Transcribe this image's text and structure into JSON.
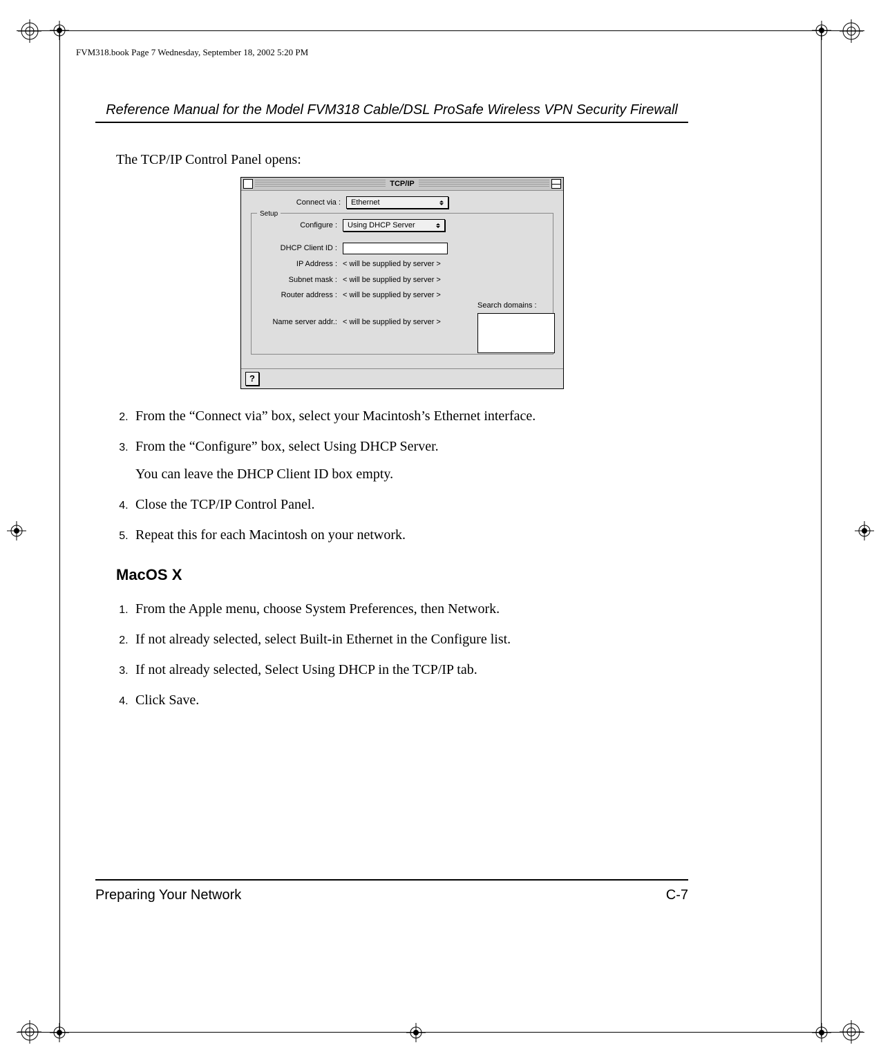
{
  "meta": {
    "book_line": "FVM318.book  Page 7  Wednesday, September 18, 2002  5:20 PM"
  },
  "header": {
    "title": "Reference Manual for the Model FVM318 Cable/DSL ProSafe Wireless VPN Security Firewall"
  },
  "intro": "The TCP/IP Control Panel opens:",
  "tcpip_panel": {
    "title": "TCP/IP",
    "connect_via_label": "Connect via :",
    "connect_via_value": "Ethernet",
    "setup_label": "Setup",
    "configure_label": "Configure :",
    "configure_value": "Using DHCP Server",
    "dhcp_client_id_label": "DHCP Client ID :",
    "ip_address_label": "IP Address :",
    "ip_address_value": "< will be supplied by server >",
    "subnet_mask_label": "Subnet mask :",
    "subnet_mask_value": "< will be supplied by server >",
    "router_address_label": "Router address :",
    "router_address_value": "< will be supplied by server >",
    "name_server_label": "Name server addr.:",
    "name_server_value": "< will be supplied by server >",
    "search_domains_label": "Search domains :",
    "help_glyph": "?"
  },
  "steps_a": {
    "s2": "From the “Connect via” box, select your Macintosh’s Ethernet interface.",
    "s3": "From the “Configure” box, select Using DHCP Server.",
    "s3_sub": "You can leave the DHCP Client ID box empty.",
    "s4": "Close the TCP/IP Control Panel.",
    "s5": "Repeat this for each Macintosh on your network."
  },
  "section_heading": "MacOS X",
  "steps_b": {
    "s1": "From the Apple menu, choose System Preferences, then Network.",
    "s2": "If not already selected, select Built-in Ethernet in the Configure list.",
    "s3": "If not already selected, Select Using DHCP in the TCP/IP tab.",
    "s4": "Click Save."
  },
  "footer": {
    "section": "Preparing Your Network",
    "page_number": "C-7"
  }
}
